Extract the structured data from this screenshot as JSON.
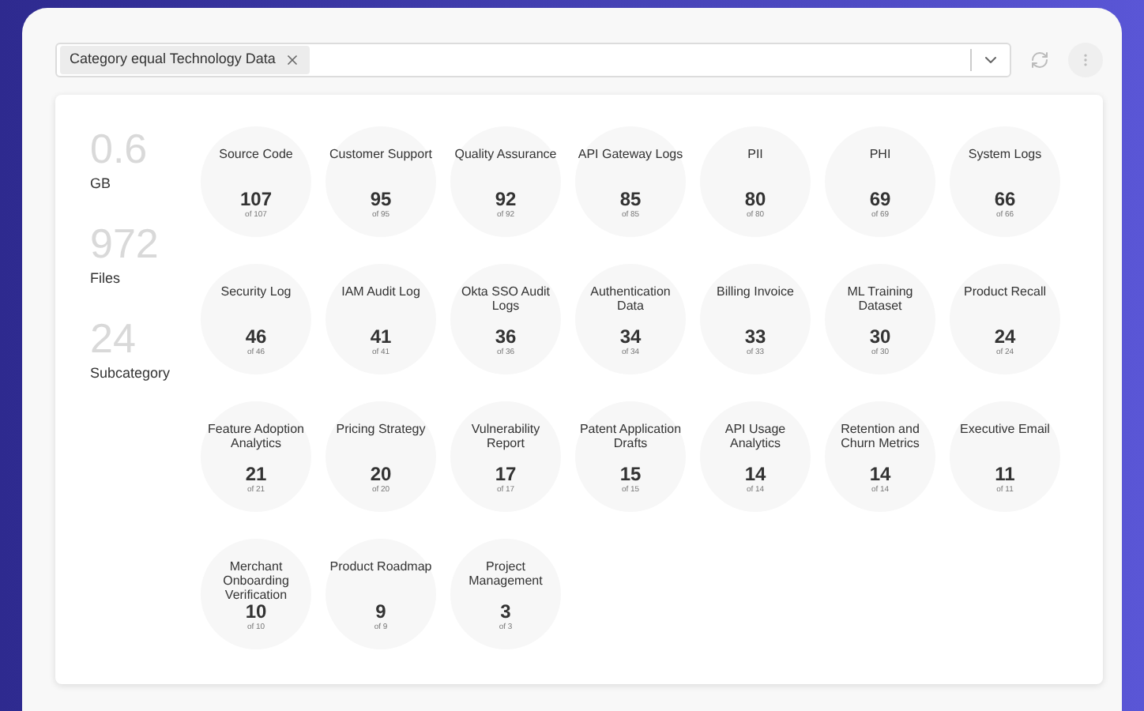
{
  "filter": {
    "chip": "Category equal Technology Data"
  },
  "stats": [
    {
      "value": "0.6",
      "label": "GB"
    },
    {
      "value": "972",
      "label": "Files"
    },
    {
      "value": "24",
      "label": "Subcategory"
    }
  ],
  "categories": [
    {
      "name": "Source Code",
      "count": "107",
      "total": "of 107"
    },
    {
      "name": "Customer Support",
      "count": "95",
      "total": "of 95"
    },
    {
      "name": "Quality Assurance",
      "count": "92",
      "total": "of 92"
    },
    {
      "name": "API Gateway Logs",
      "count": "85",
      "total": "of 85"
    },
    {
      "name": "PII",
      "count": "80",
      "total": "of 80"
    },
    {
      "name": "PHI",
      "count": "69",
      "total": "of 69"
    },
    {
      "name": "System Logs",
      "count": "66",
      "total": "of 66"
    },
    {
      "name": "Security Log",
      "count": "46",
      "total": "of 46"
    },
    {
      "name": "IAM Audit Log",
      "count": "41",
      "total": "of 41"
    },
    {
      "name": "Okta SSO Audit Logs",
      "count": "36",
      "total": "of 36"
    },
    {
      "name": "Authentication Data",
      "count": "34",
      "total": "of 34"
    },
    {
      "name": "Billing Invoice",
      "count": "33",
      "total": "of 33"
    },
    {
      "name": "ML Training Dataset",
      "count": "30",
      "total": "of 30"
    },
    {
      "name": "Product Recall",
      "count": "24",
      "total": "of 24"
    },
    {
      "name": "Feature Adoption Analytics",
      "count": "21",
      "total": "of 21"
    },
    {
      "name": "Pricing Strategy",
      "count": "20",
      "total": "of 20"
    },
    {
      "name": "Vulnerability Report",
      "count": "17",
      "total": "of 17"
    },
    {
      "name": "Patent Application Drafts",
      "count": "15",
      "total": "of 15"
    },
    {
      "name": "API Usage Analytics",
      "count": "14",
      "total": "of 14"
    },
    {
      "name": "Retention and Churn Metrics",
      "count": "14",
      "total": "of 14"
    },
    {
      "name": "Executive Email",
      "count": "11",
      "total": "of 11"
    },
    {
      "name": "Merchant Onboarding Verification",
      "count": "10",
      "total": "of 10"
    },
    {
      "name": "Product Roadmap",
      "count": "9",
      "total": "of 9"
    },
    {
      "name": "Project Management",
      "count": "3",
      "total": "of 3"
    }
  ]
}
